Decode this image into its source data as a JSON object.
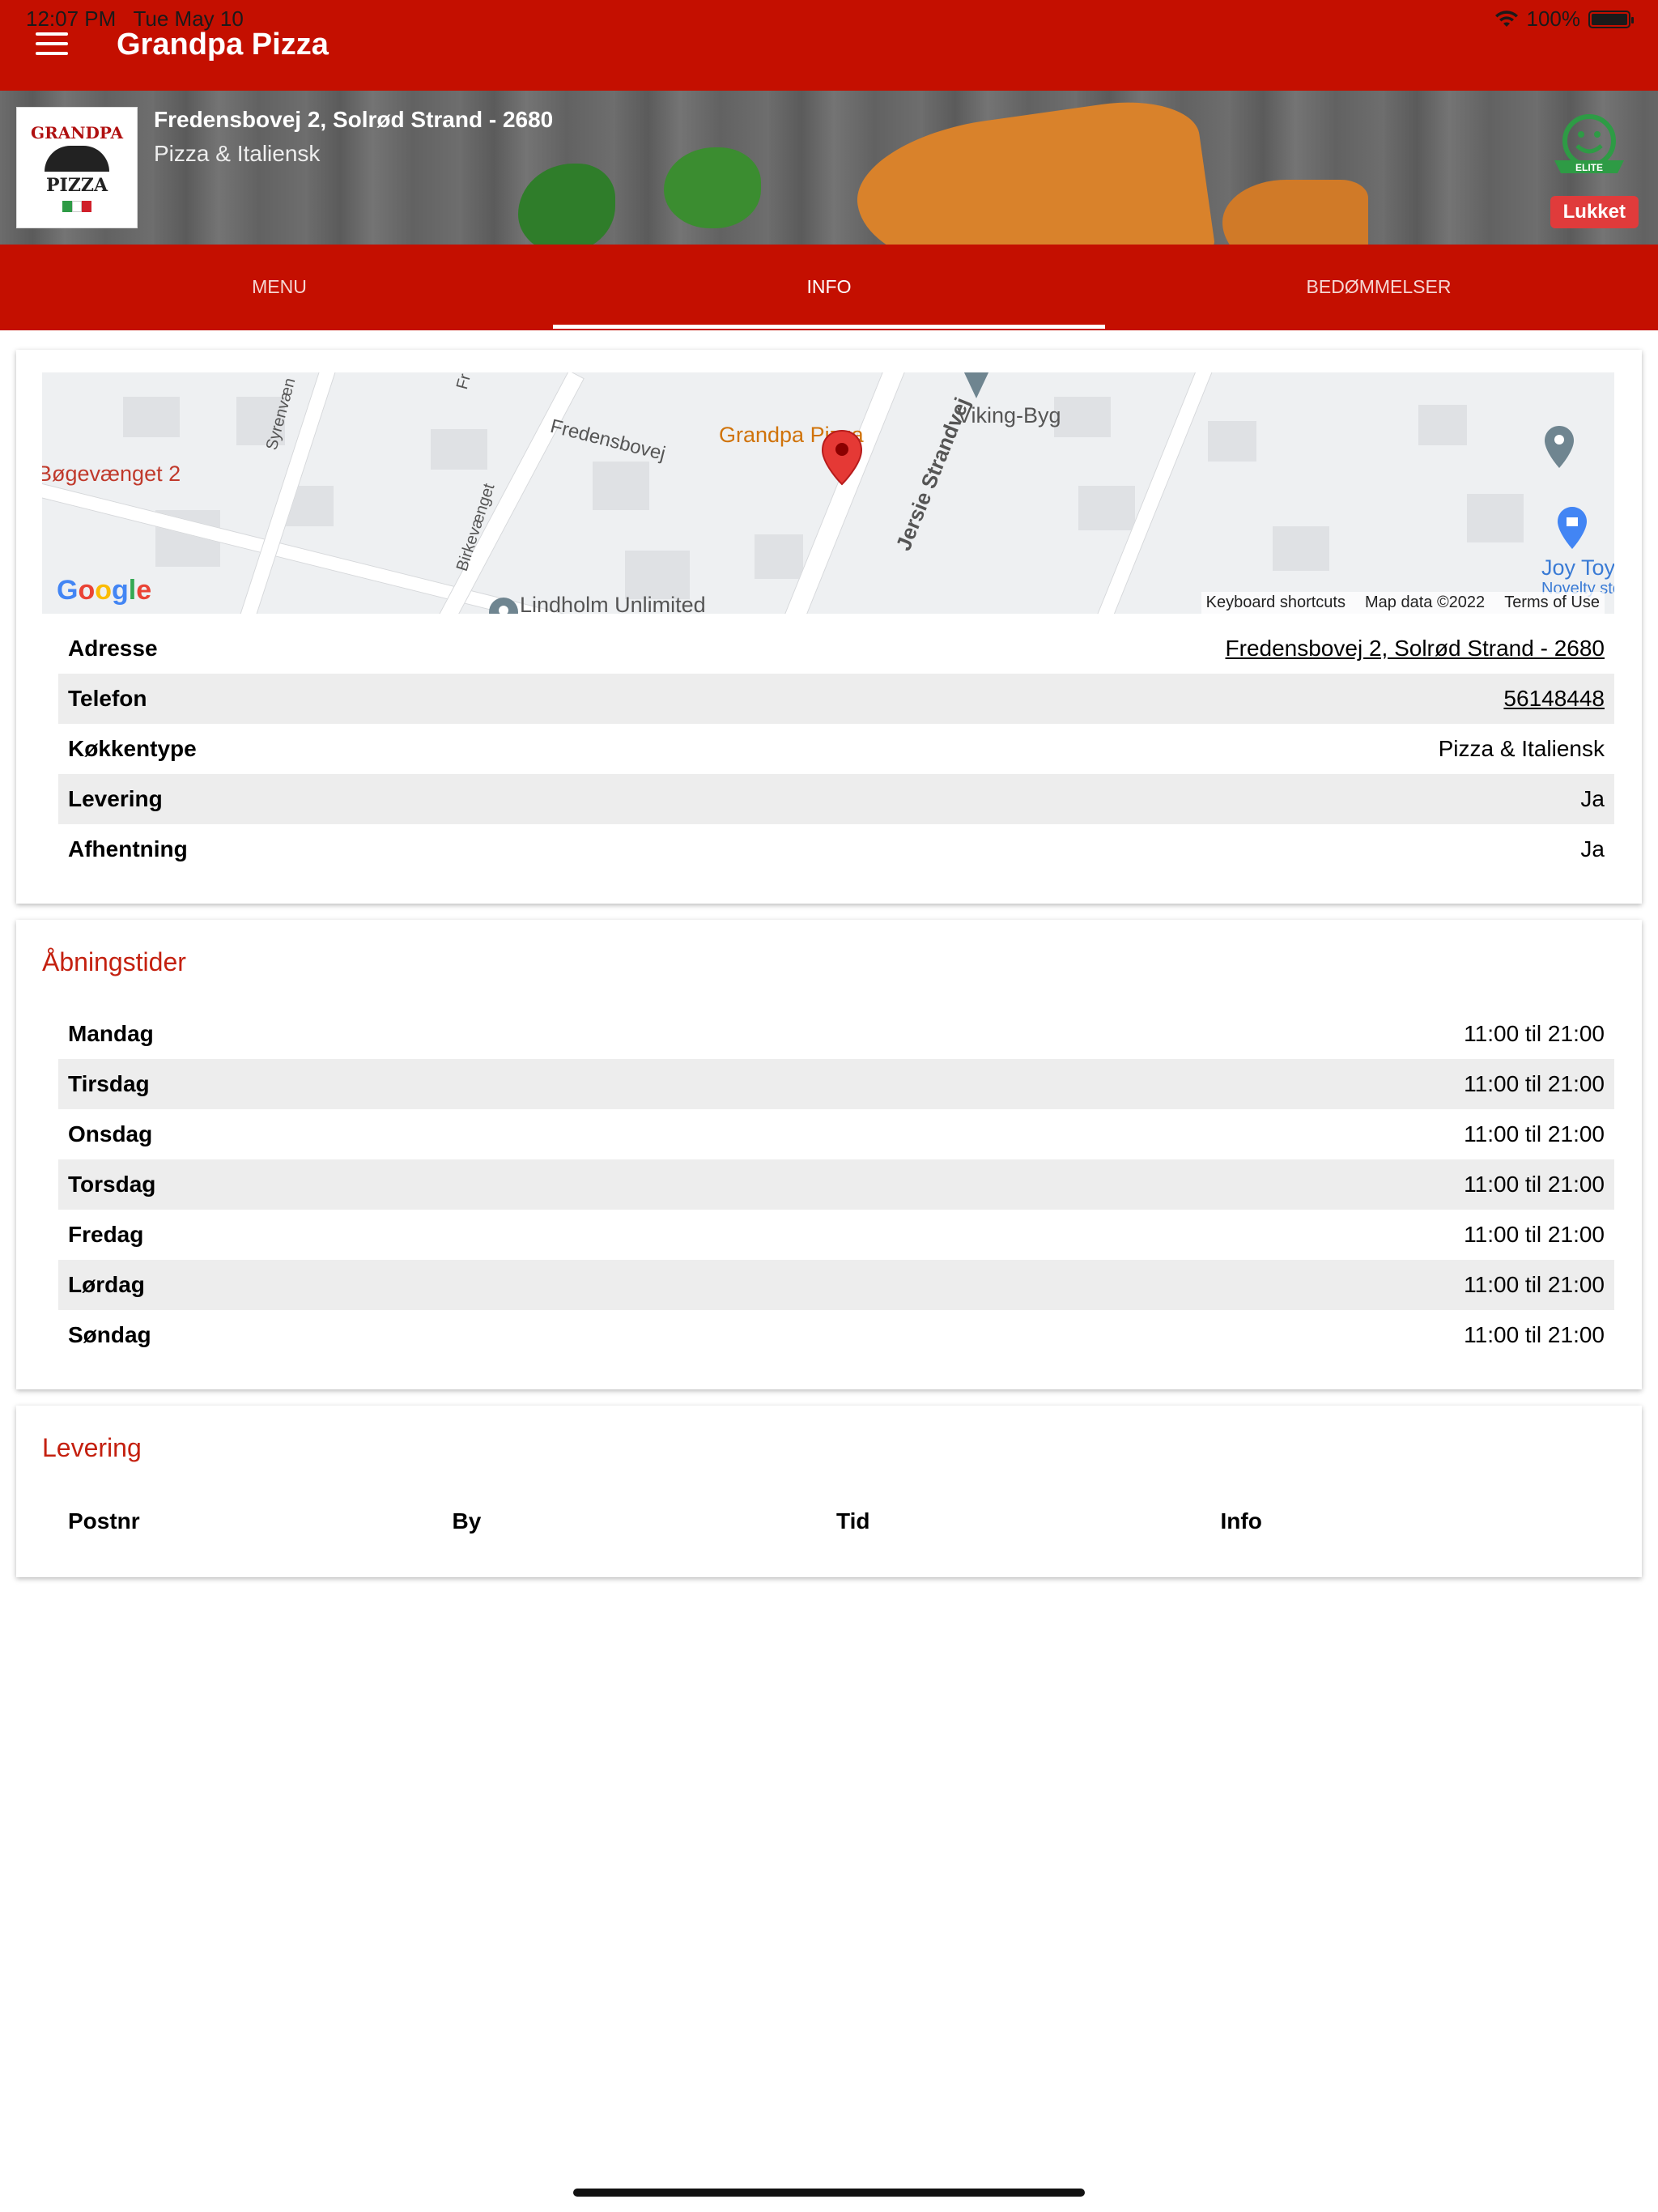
{
  "status_bar": {
    "time": "12:07 PM",
    "date": "Tue May 10",
    "battery": "100%"
  },
  "app": {
    "title": "Grandpa Pizza"
  },
  "restaurant": {
    "address": "Fredensbovej 2, Solrød Strand - 2680",
    "cuisine": "Pizza & Italiensk",
    "status": "Lukket",
    "logo_text_top": "GRANDPA",
    "logo_text_bottom": "PIZZA",
    "smiley_label": "ELITE"
  },
  "tabs": [
    {
      "label": "MENU",
      "active": false
    },
    {
      "label": "INFO",
      "active": true
    },
    {
      "label": "BEDØMMELSER",
      "active": false
    }
  ],
  "map": {
    "labels": {
      "bogevaenget": "Bøgevænget 2",
      "syrenvaen": "Syrenvæn",
      "fr": "Fr",
      "fredensbovej": "Fredensbovej",
      "grandpa": "Grandpa Pizza",
      "viking": "Viking-Byg",
      "jersie": "Jersie Strandvej",
      "birkevaenget": "Birkevænget",
      "lindholm": "Lindholm Unlimited",
      "joytoy": "Joy Toy v",
      "novelty": "Novelty sto"
    },
    "google": "Google",
    "footer": [
      "Keyboard shortcuts",
      "Map data ©2022",
      "Terms of Use"
    ]
  },
  "info_rows": [
    {
      "key": "Adresse",
      "value": "Fredensbovej 2, Solrød Strand - 2680",
      "link": true
    },
    {
      "key": "Telefon",
      "value": "56148448",
      "link": true
    },
    {
      "key": "Køkkentype",
      "value": "Pizza & Italiensk",
      "link": false
    },
    {
      "key": "Levering",
      "value": "Ja",
      "link": false
    },
    {
      "key": "Afhentning",
      "value": "Ja",
      "link": false
    }
  ],
  "hours": {
    "title": "Åbningstider",
    "rows": [
      {
        "day": "Mandag",
        "time": "11:00 til 21:00"
      },
      {
        "day": "Tirsdag",
        "time": "11:00 til 21:00"
      },
      {
        "day": "Onsdag",
        "time": "11:00 til 21:00"
      },
      {
        "day": "Torsdag",
        "time": "11:00 til 21:00"
      },
      {
        "day": "Fredag",
        "time": "11:00 til 21:00"
      },
      {
        "day": "Lørdag",
        "time": "11:00 til 21:00"
      },
      {
        "day": "Søndag",
        "time": "11:00 til 21:00"
      }
    ]
  },
  "delivery": {
    "title": "Levering",
    "columns": [
      "Postnr",
      "By",
      "Tid",
      "Info"
    ]
  },
  "colors": {
    "brand_red": "#c40f00",
    "section_title": "#c4200f",
    "closed_badge": "#e03b3b",
    "row_alt": "#ededed"
  }
}
